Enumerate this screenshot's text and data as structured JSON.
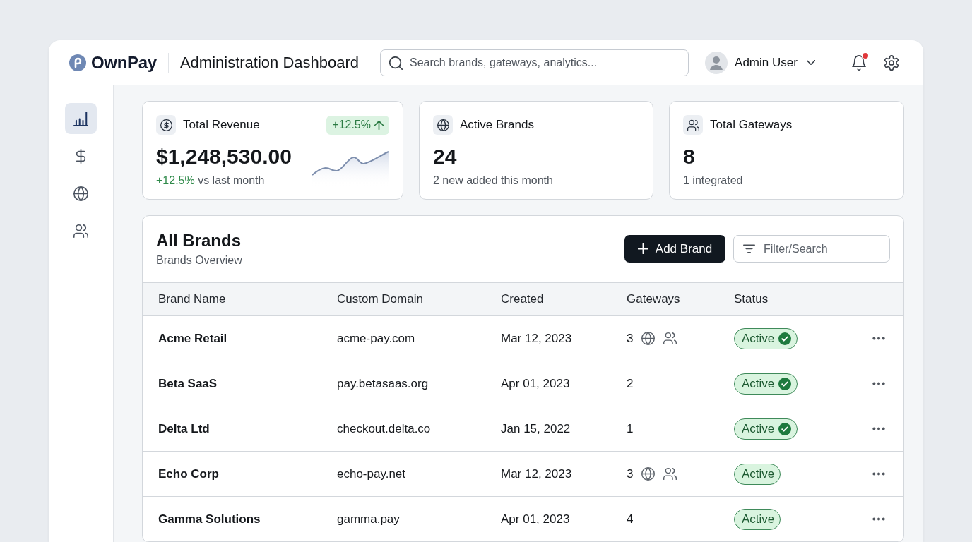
{
  "app": {
    "name": "OwnPay"
  },
  "header": {
    "title": "Administration Dashboard",
    "search": {
      "placeholder": "Search brands, gateways, analytics..."
    },
    "user": {
      "name": "Admin User"
    },
    "notifications": {
      "unread": true
    }
  },
  "sidebar": {
    "items": [
      {
        "selected": true
      },
      {
        "selected": false
      },
      {
        "selected": false
      },
      {
        "selected": false
      }
    ]
  },
  "stats": [
    {
      "kind": "trend",
      "label": "Total Revenue",
      "badge": "+12.5%",
      "value": "$1,248,530.00",
      "change": "+12.5%",
      "note": "vs last month"
    },
    {
      "kind": "plain",
      "label": "Active Brands",
      "value": "24",
      "note": "2 new added this month"
    },
    {
      "kind": "plain",
      "label": "Total Gateways",
      "value": "8",
      "note": "1 integrated"
    }
  ],
  "brands": {
    "title": "All Brands",
    "subtitle": "Brands Overview",
    "add_button": "Add Brand",
    "filter": {
      "placeholder": "Filter/Search"
    },
    "columns": [
      "Brand Name",
      "Custom Domain",
      "Created",
      "Gateways",
      "Status"
    ],
    "rows": [
      {
        "name": "Acme Retail",
        "domain": "acme-pay.com",
        "created": "Mar 12, 2023",
        "gateways": "3",
        "icons": true,
        "status": "Active",
        "verified": true
      },
      {
        "name": "Beta SaaS",
        "domain": "pay.betasaas.org",
        "created": "Apr 01, 2023",
        "gateways": "2",
        "icons": false,
        "status": "Active",
        "verified": true
      },
      {
        "name": "Delta Ltd",
        "domain": "checkout.delta.co",
        "created": "Jan 15, 2022",
        "gateways": "1",
        "icons": false,
        "status": "Active",
        "verified": true
      },
      {
        "name": "Echo Corp",
        "domain": "echo-pay.net",
        "created": "Mar 12, 2023",
        "gateways": "3",
        "icons": true,
        "status": "Active",
        "verified": false
      },
      {
        "name": "Gamma Solutions",
        "domain": "gamma.pay",
        "created": "Apr 01, 2023",
        "gateways": "4",
        "icons": false,
        "status": "Active",
        "verified": false
      }
    ]
  }
}
